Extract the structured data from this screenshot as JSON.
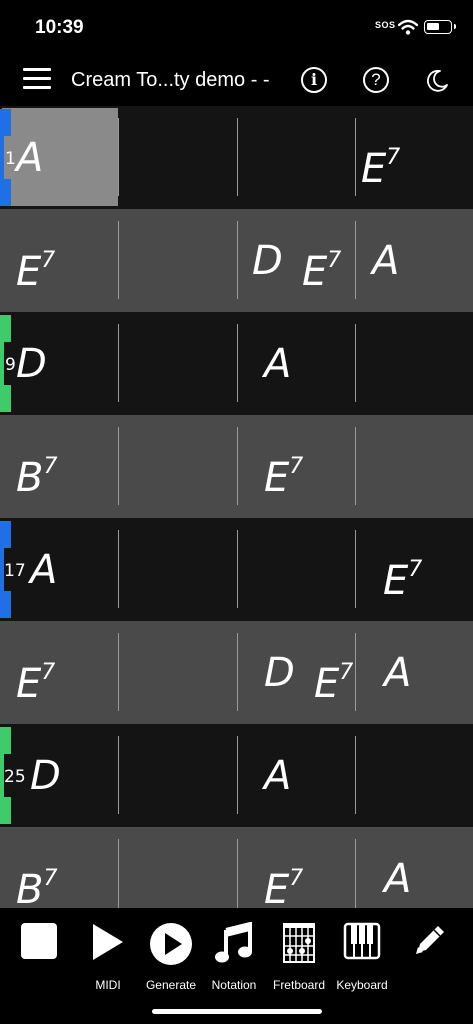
{
  "status": {
    "time": "10:39",
    "sos": "SOS"
  },
  "header": {
    "title": "Cream To...ty demo - -",
    "info_icon": "i",
    "help_icon": "?"
  },
  "rows": [
    {
      "bar_number": "1",
      "marker": "blue",
      "cells": [
        {
          "root": "A",
          "ext": ""
        },
        null,
        null,
        {
          "root": "E",
          "ext": "7"
        }
      ]
    },
    {
      "bar_number": "",
      "marker": "",
      "cells": [
        {
          "root": "E",
          "ext": "7"
        },
        null,
        [
          {
            "root": "D",
            "ext": ""
          },
          {
            "root": "E",
            "ext": "7"
          }
        ],
        {
          "root": "A",
          "ext": ""
        }
      ]
    },
    {
      "bar_number": "9",
      "marker": "green",
      "cells": [
        {
          "root": "D",
          "ext": ""
        },
        null,
        {
          "root": "A",
          "ext": ""
        },
        null
      ]
    },
    {
      "bar_number": "",
      "marker": "",
      "cells": [
        {
          "root": "B",
          "ext": "7"
        },
        null,
        {
          "root": "E",
          "ext": "7"
        },
        null
      ]
    },
    {
      "bar_number": "17",
      "marker": "blue",
      "cells": [
        {
          "root": "A",
          "ext": ""
        },
        null,
        null,
        {
          "root": "E",
          "ext": "7"
        }
      ]
    },
    {
      "bar_number": "",
      "marker": "",
      "cells": [
        {
          "root": "E",
          "ext": "7"
        },
        null,
        [
          {
            "root": "D",
            "ext": ""
          },
          {
            "root": "E",
            "ext": "7"
          }
        ],
        {
          "root": "A",
          "ext": ""
        }
      ]
    },
    {
      "bar_number": "25",
      "marker": "green",
      "cells": [
        {
          "root": "D",
          "ext": ""
        },
        null,
        {
          "root": "A",
          "ext": ""
        },
        null
      ]
    },
    {
      "bar_number": "",
      "marker": "",
      "cells": [
        {
          "root": "B",
          "ext": "7"
        },
        null,
        {
          "root": "E",
          "ext": "7"
        },
        {
          "root": "A",
          "ext": ""
        }
      ]
    }
  ],
  "toolbar": {
    "stop": {
      "label": "",
      "icon": "stop-icon"
    },
    "midi": {
      "label": "MIDI",
      "icon": "play-icon"
    },
    "generate": {
      "label": "Generate",
      "icon": "play-circle-icon"
    },
    "notation": {
      "label": "Notation",
      "icon": "music-note-icon"
    },
    "fretboard": {
      "label": "Fretboard",
      "icon": "fretboard-icon"
    },
    "keyboard": {
      "label": "Keyboard",
      "icon": "keyboard-icon"
    },
    "edit": {
      "label": "",
      "icon": "pencil-icon"
    }
  },
  "colors": {
    "row_dark": "#141414",
    "row_light": "#4a4a4a",
    "marker_blue": "#1f6fe5",
    "marker_green": "#3ecc6a",
    "highlight": "#8a8a8a"
  }
}
